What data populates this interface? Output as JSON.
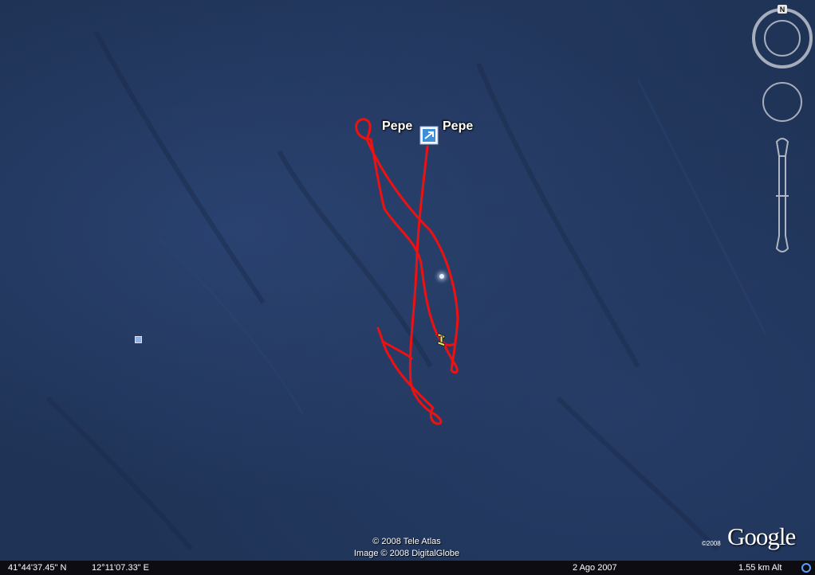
{
  "map": {
    "placemark_left_label": "Pepe",
    "placemark_right_label": "Pepe"
  },
  "attribution": {
    "line1": "© 2008 Tele Atlas",
    "line2": "Image © 2008 DigitalGlobe"
  },
  "logo": {
    "year": "©2008",
    "name": "Google"
  },
  "compass": {
    "north_label": "N"
  },
  "status": {
    "latitude": "41°44'37.45\" N",
    "longitude": "12°11'07.33\" E",
    "date": "2 Ago 2007",
    "altitude": "1.55 km Alt"
  },
  "colors": {
    "track": "#ee1111",
    "ocean": "#1f3356"
  }
}
